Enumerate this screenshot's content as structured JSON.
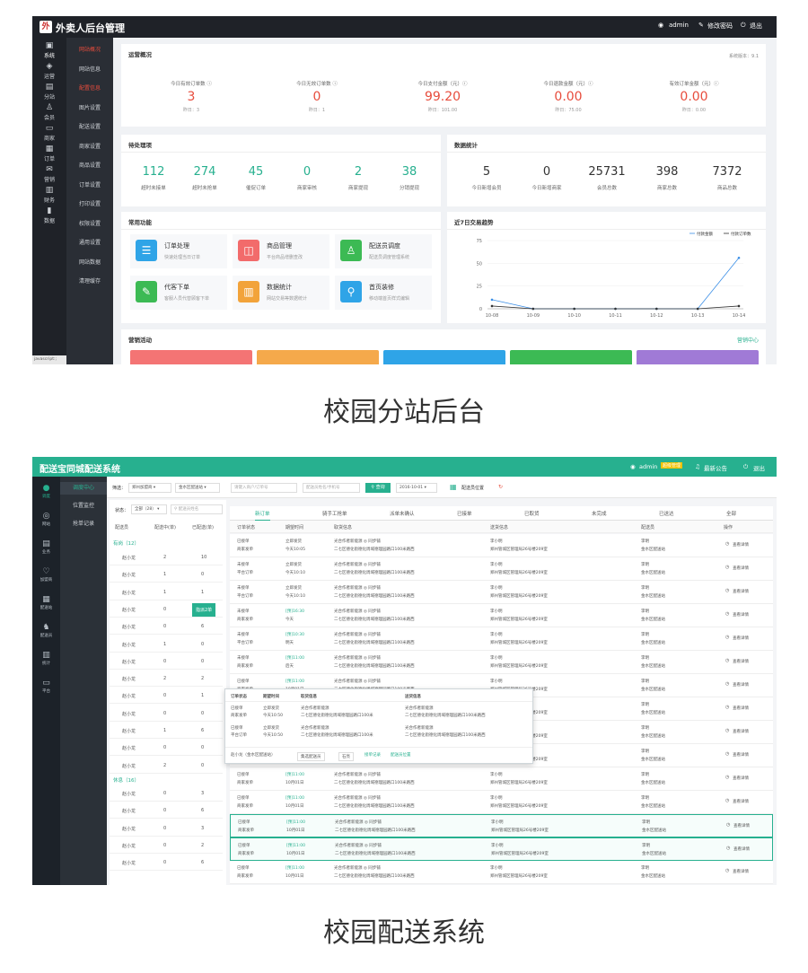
{
  "admin1": {
    "app_title": "外卖人后台管理",
    "logo_text": "外",
    "topbar": {
      "user": "admin",
      "change_pwd": "修改密码",
      "logout": "退出"
    },
    "icon_nav": [
      {
        "label": "系统",
        "glyph": "▣"
      },
      {
        "label": "运营",
        "glyph": "◈"
      },
      {
        "label": "分站",
        "glyph": "▤"
      },
      {
        "label": "会员",
        "glyph": "♙"
      },
      {
        "label": "商家",
        "glyph": "▭"
      },
      {
        "label": "订单",
        "glyph": "▦"
      },
      {
        "label": "营销",
        "glyph": "✉"
      },
      {
        "label": "财务",
        "glyph": "▥"
      },
      {
        "label": "数据",
        "glyph": "▮"
      }
    ],
    "sub_nav": [
      "网站概况",
      "网站信息",
      "配置信息",
      "图片设置",
      "配送设置",
      "商家设置",
      "商品设置",
      "订单设置",
      "打印设置",
      "权限设置",
      "通用设置",
      "网站数据",
      "清理缓存"
    ],
    "status_text": "javascript:;",
    "overview": {
      "title": "运营概况",
      "version": "系统版本：9.1",
      "stats": [
        {
          "label": "今日有效订单数 ⓘ",
          "value": "3",
          "sub": "昨日：3"
        },
        {
          "label": "今日无效订单数 ⓘ",
          "value": "0",
          "sub": "昨日：1"
        },
        {
          "label": "今日支付金额（元）ⓘ",
          "value": "99.20",
          "sub": "昨日：101.00"
        },
        {
          "label": "今日退款金额（元）ⓘ",
          "value": "0.00",
          "sub": "昨日：75.00"
        },
        {
          "label": "有效订单金额（元）ⓘ",
          "value": "0.00",
          "sub": "昨日：0.00"
        }
      ]
    },
    "pending": {
      "title": "待处理项",
      "items": [
        {
          "value": "112",
          "label": "超时未接单"
        },
        {
          "value": "274",
          "label": "超时未抢单"
        },
        {
          "value": "45",
          "label": "催促订单"
        },
        {
          "value": "0",
          "label": "商家审核"
        },
        {
          "value": "2",
          "label": "商家提现"
        },
        {
          "value": "38",
          "label": "分销提现"
        }
      ]
    },
    "datastats": {
      "title": "数据统计",
      "items": [
        {
          "value": "5",
          "label": "今日新增会员"
        },
        {
          "value": "0",
          "label": "今日新增商家"
        },
        {
          "value": "25731",
          "label": "会员总数"
        },
        {
          "value": "398",
          "label": "商家总数"
        },
        {
          "value": "7372",
          "label": "商品总数"
        }
      ]
    },
    "functions": {
      "title": "常用功能",
      "items": [
        {
          "name": "订单处理",
          "desc": "快速处理当日订单",
          "glyph": "☰",
          "color": "#2fa4e7"
        },
        {
          "name": "商品管理",
          "desc": "平台商品增删查改",
          "glyph": "◫",
          "color": "#f26b6b"
        },
        {
          "name": "配送员调度",
          "desc": "配送员调度管理系统",
          "glyph": "♙",
          "color": "#3cba54"
        },
        {
          "name": "代客下单",
          "desc": "客服人员代替顾客下单",
          "glyph": "✎",
          "color": "#3cba54"
        },
        {
          "name": "数据统计",
          "desc": "网站交易等数据统计",
          "glyph": "▥",
          "color": "#f2a33a"
        },
        {
          "name": "首页装修",
          "desc": "移动端首页样式编辑",
          "glyph": "⚲",
          "color": "#2fa4e7"
        }
      ]
    },
    "chart": {
      "title": "近7日交易趋势",
      "legend": [
        "付款金额",
        "付款订单数"
      ]
    },
    "marketing": {
      "title": "营销活动",
      "link": "营销中心",
      "bars": [
        "#f47474",
        "#f5a94b",
        "#2fa4e7",
        "#3cba54",
        "#a07ad6"
      ]
    }
  },
  "chart_data": {
    "type": "line",
    "categories": [
      "10-08",
      "10-09",
      "10-10",
      "10-11",
      "10-12",
      "10-13",
      "10-14"
    ],
    "series": [
      {
        "name": "付款金额",
        "values": [
          10,
          0,
          0,
          0,
          0,
          0,
          56
        ]
      },
      {
        "name": "付款订单数",
        "values": [
          3,
          0,
          0,
          0,
          0,
          0,
          3
        ]
      }
    ],
    "ylim": [
      0,
      75
    ],
    "yticks": [
      "0",
      "25",
      "50",
      "75"
    ],
    "colors": [
      "#3a8ee6",
      "#333333"
    ],
    "legend_position": "top-right"
  },
  "caption1": "校园分站后台",
  "caption2": "校园配送系统",
  "admin2": {
    "app_title": "配送宝同城配送系统",
    "topbar": {
      "user": "admin",
      "badge": "超级管理",
      "notice": "最新公告",
      "logout": "退出"
    },
    "icon_nav": [
      {
        "label": "调度",
        "glyph": "●"
      },
      {
        "label": "网站",
        "glyph": "◎"
      },
      {
        "label": "业务",
        "glyph": "▤"
      },
      {
        "label": "加盟商",
        "glyph": "♡"
      },
      {
        "label": "配送站",
        "glyph": "▦"
      },
      {
        "label": "配送员",
        "glyph": "♞"
      },
      {
        "label": "统计",
        "glyph": "▥"
      },
      {
        "label": "平台",
        "glyph": "▭"
      }
    ],
    "sub_nav": [
      "调度中心",
      "位置监控",
      "抢单记录"
    ],
    "filter": {
      "label": "筛选：",
      "franchise": "郑州加盟商",
      "station": "金水区配送站",
      "search_placeholder": "请键入商户/订单号",
      "courier_placeholder": "配送员姓名/手机号",
      "query": "查询",
      "date": "2016-10-01",
      "location": "配送员位置"
    },
    "left": {
      "status_label": "状态：",
      "status_value": "全部（28）",
      "search_placeholder": "配送员姓名",
      "headers": [
        "配送员",
        "配送中(单)",
        "已配送(单)"
      ],
      "group1": "有岗（12）",
      "group2": "休息（16）",
      "rows1": [
        {
          "name": "赵小龙",
          "a": "2",
          "b": "10"
        },
        {
          "name": "赵小龙",
          "a": "1",
          "b": "0"
        },
        {
          "name": "赵小龙",
          "a": "1",
          "b": "1"
        },
        {
          "name": "赵小龙",
          "a": "0",
          "b": "指派2单"
        },
        {
          "name": "赵小龙",
          "a": "0",
          "b": "6"
        },
        {
          "name": "赵小龙",
          "a": "1",
          "b": "0"
        },
        {
          "name": "赵小龙",
          "a": "0",
          "b": "0"
        },
        {
          "name": "赵小龙",
          "a": "2",
          "b": "2"
        },
        {
          "name": "赵小龙",
          "a": "0",
          "b": "1"
        },
        {
          "name": "赵小龙",
          "a": "0",
          "b": "0"
        },
        {
          "name": "赵小龙",
          "a": "1",
          "b": "6"
        },
        {
          "name": "赵小龙",
          "a": "0",
          "b": "0"
        },
        {
          "name": "赵小龙",
          "a": "2",
          "b": "0"
        }
      ],
      "rows2": [
        {
          "name": "赵小龙",
          "a": "0",
          "b": "3"
        },
        {
          "name": "赵小龙",
          "a": "0",
          "b": "6"
        },
        {
          "name": "赵小龙",
          "a": "0",
          "b": "3"
        },
        {
          "name": "赵小龙",
          "a": "0",
          "b": "2"
        },
        {
          "name": "赵小龙",
          "a": "0",
          "b": "6"
        }
      ]
    },
    "tabs": [
      "新订单",
      "骑手工抢单",
      "派单未确认",
      "已接单",
      "已取货",
      "未完成",
      "已送达",
      "全部"
    ],
    "table_headers": [
      "订单状态",
      "期望时间",
      "取货信息",
      "送货信息",
      "配送员",
      "操作"
    ],
    "orders": [
      {
        "status": "已接单",
        "source": "商家发单",
        "time": "立即发货",
        "time2": "今天10:05",
        "pick": "光合作者新能源  ◎ 同步铺",
        "pick2": "二七区德化街德化周域德理园路口100米路西",
        "to": "李小明",
        "to2": "郑州管城区管理局26号楼209室",
        "courier": "李明",
        "courier2": "金水区配送站",
        "op": "查看详情"
      },
      {
        "status": "未接单",
        "source": "平台订单",
        "time": "立即发货",
        "time2": "今天10:10",
        "pick": "光合作者新能源  ◎ 同步铺",
        "pick2": "二七区德化街德化周域德理园路口100米路西",
        "to": "李小明",
        "to2": "郑州管城区管理局26号楼209室",
        "courier": "李明",
        "courier2": "金水区配送站",
        "op": "查看详情"
      },
      {
        "status": "未接单",
        "source": "平台订单",
        "time": "立即发货",
        "time2": "今天10:10",
        "pick": "光合作者新能源  ◎ 同步铺",
        "pick2": "二七区德化街德化周域德理园路口100米路西",
        "to": "李小明",
        "to2": "郑州管城区管理局26号楼209室",
        "courier": "李明",
        "courier2": "金水区配送站",
        "op": "查看详情"
      },
      {
        "status": "未接单",
        "source": "商家发单",
        "time": "[预]16:30",
        "time2": "今天",
        "pick": "光合作者新能源  ◎ 同步铺",
        "pick2": "二七区德化街德化周域德理园路口100米路西",
        "to": "李小明",
        "to2": "郑州管城区管理局26号楼209室",
        "courier": "李明",
        "courier2": "金水区配送站",
        "op": "查看详情"
      },
      {
        "status": "未接单",
        "source": "平台订单",
        "time": "[预]10:30",
        "time2": "明天",
        "pick": "光合作者新能源  ◎ 同步铺",
        "pick2": "二七区德化街德化周域德理园路口100米路西",
        "to": "李小明",
        "to2": "郑州管城区管理局26号楼209室",
        "courier": "李明",
        "courier2": "金水区配送站",
        "op": "查看详情"
      },
      {
        "status": "未接单",
        "source": "商家发单",
        "time": "[预]11:00",
        "time2": "后天",
        "pick": "光合作者新能源  ◎ 同步铺",
        "pick2": "二七区德化街德化周域德理园路口100米路西",
        "to": "李小明",
        "to2": "郑州管城区管理局26号楼209室",
        "courier": "李明",
        "courier2": "金水区配送站",
        "op": "查看详情"
      },
      {
        "status": "已接单",
        "source": "商家发单",
        "time": "[预]11:00",
        "time2": "10月01日",
        "pick": "光合作者新能源  ◎ 同步铺",
        "pick2": "二七区德化街德化周域德理园路口100米路西",
        "to": "李小明",
        "to2": "郑州管城区管理局26号楼209室",
        "courier": "李明",
        "courier2": "金水区配送站",
        "op": "查看详情"
      },
      {
        "status": "已接单",
        "source": "商家发单",
        "time": "[预]11:00",
        "time2": "10月01日",
        "pick": "光合作者新能源  ◎ 同步铺",
        "pick2": "二七区德化街德化周域德理园路口100米路西",
        "to": "李小明",
        "to2": "郑州管城区管理局26号楼209室",
        "courier": "李明",
        "courier2": "金水区配送站",
        "op": "查看详情"
      },
      {
        "status": "已接单",
        "source": "商家发单",
        "time": "[预]11:00",
        "time2": "10月01日",
        "pick": "光合作者新能源  ◎ 同步铺",
        "pick2": "二七区德化街德化周域德理园路口100米路西",
        "to": "李小明",
        "to2": "郑州管城区管理局26号楼209室",
        "courier": "李明",
        "courier2": "金水区配送站",
        "op": "查看详情"
      },
      {
        "status": "已接单",
        "source": "商家发单",
        "time": "[预]11:00",
        "time2": "10月01日",
        "pick": "光合作者新能源  ◎ 同步铺",
        "pick2": "二七区德化街德化周域德理园路口100米路西",
        "to": "李小明",
        "to2": "郑州管城区管理局26号楼209室",
        "courier": "李明",
        "courier2": "金水区配送站",
        "op": "查看详情"
      },
      {
        "status": "已接单",
        "source": "商家发单",
        "time": "[预]11:00",
        "time2": "10月01日",
        "pick": "光合作者新能源  ◎ 同步铺",
        "pick2": "二七区德化街德化周域德理园路口100米路西",
        "to": "李小明",
        "to2": "郑州管城区管理局26号楼209室",
        "courier": "李明",
        "courier2": "金水区配送站",
        "op": "查看详情"
      },
      {
        "status": "已接单",
        "source": "商家发单",
        "time": "[预]11:00",
        "time2": "10月01日",
        "pick": "光合作者新能源  ◎ 同步铺",
        "pick2": "二七区德化街德化周域德理园路口100米路西",
        "to": "李小明",
        "to2": "郑州管城区管理局26号楼209室",
        "courier": "李明",
        "courier2": "金水区配送站",
        "op": "查看详情"
      },
      {
        "status": "已接单",
        "source": "商家发单",
        "time": "[预]11:00",
        "time2": "10月01日",
        "pick": "光合作者新能源  ◎ 同步铺",
        "pick2": "二七区德化街德化周域德理园路口100米路西",
        "to": "李小明",
        "to2": "郑州管城区管理局26号楼209室",
        "courier": "李明",
        "courier2": "金水区配送站",
        "op": "查看详情"
      },
      {
        "status": "已接单",
        "source": "商家发单",
        "time": "[预]11:00",
        "time2": "10月01日",
        "pick": "光合作者新能源  ◎ 同步铺",
        "pick2": "二七区德化街德化周域德理园路口100米路西",
        "to": "李小明",
        "to2": "郑州管城区管理局26号楼209室",
        "courier": "李明",
        "courier2": "金水区配送站",
        "op": "查看详情"
      },
      {
        "status": "已接单",
        "source": "商家发单",
        "time": "[预]11:00",
        "time2": "10月01日",
        "pick": "光合作者新能源  ◎ 同步铺",
        "pick2": "二七区德化街德化周域德理园路口100米路西",
        "to": "李小明",
        "to2": "郑州管城区管理局26号楼209室",
        "courier": "李明",
        "courier2": "金水区配送站",
        "op": "查看详情"
      }
    ],
    "popup": {
      "headers": [
        "订单状态",
        "期望时间",
        "取货信息",
        "送货信息"
      ],
      "rows": [
        {
          "status": "已接单",
          "source": "商家发单",
          "time": "立即发货",
          "time2": "今天10:50",
          "pick": "光合作者新能源",
          "pick2": "二七区德化街德化周域德理园路口100米",
          "to": "光合作者新能源",
          "to2": "二七区德化街德化周域德理园路口100米路西"
        },
        {
          "status": "已接单",
          "source": "平台订单",
          "time": "立即发货",
          "time2": "今天10:50",
          "pick": "光合作者新能源",
          "pick2": "二七区德化街德化周域德理园路口100米",
          "to": "光合作者新能源",
          "to2": "二七区德化街德化周域德理园路口100米路西"
        }
      ],
      "footer": {
        "courier": "赵小龙（金水区配送站）",
        "select": "集选配送员",
        "send": "石亮",
        "record": "接单记录",
        "location": "配送员位置"
      }
    }
  }
}
